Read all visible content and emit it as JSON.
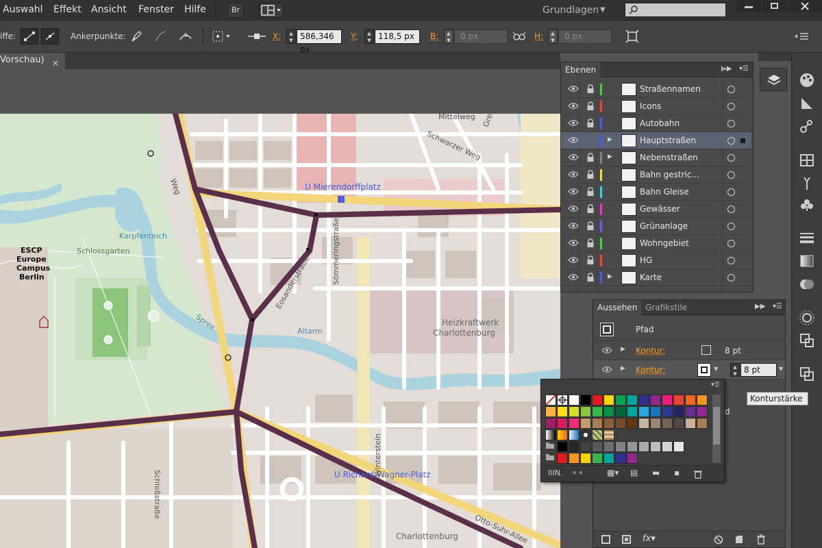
{
  "menubar": {
    "items": [
      "Auswahl",
      "Effekt",
      "Ansicht",
      "Fenster",
      "Hilfe"
    ],
    "bridge_label": "Br",
    "workspace": "Grundlagen",
    "search_placeholder": ""
  },
  "controlbar": {
    "left_label": "iffe:",
    "anchor_label": "Ankerpunkte:",
    "x_label": "X:",
    "x_value": "586,346 px",
    "y_label": "Y:",
    "y_value": "118,5 px",
    "b_label": "B:",
    "b_value": "0 px",
    "h_label": "H:",
    "h_value": "0 px"
  },
  "document": {
    "tab_title": "Vorschau)",
    "close_glyph": "×"
  },
  "map": {
    "labels": [
      "U Mierendorffplatz",
      "Karpfenteich",
      "Schlossgarten",
      "ESCP",
      "Europe",
      "Campus",
      "Berlin",
      "Spree",
      "Altarm",
      "Heizkraftwerk",
      "Charlottenburg",
      "Sömmeringstraße",
      "Mittelweg",
      "Schwarzer Weg",
      "U Richard-Wagner-Platz",
      "Otto-Suhr-Allee",
      "Schloßstraße",
      "Charlottenburg",
      "Gren",
      "Weg",
      "Eosanderstraße",
      "Winterstein"
    ]
  },
  "layers_panel": {
    "tab": "Ebenen",
    "layers": [
      {
        "name": "Straßennamen",
        "color": "#4ccc4c",
        "locked": true,
        "expandable": false,
        "selected": false
      },
      {
        "name": "Icons",
        "color": "#e04a3a",
        "locked": true,
        "expandable": false,
        "selected": false
      },
      {
        "name": "Autobahn",
        "color": "#4a5ee0",
        "locked": true,
        "expandable": false,
        "selected": false
      },
      {
        "name": "Hauptstraßen",
        "color": "#4a5ee0",
        "locked": false,
        "expandable": true,
        "selected": true
      },
      {
        "name": "Nebenstraßen",
        "color": "#808080",
        "locked": true,
        "expandable": true,
        "selected": false
      },
      {
        "name": "Bahn gestric...",
        "color": "#e6e04a",
        "locked": true,
        "expandable": false,
        "selected": false
      },
      {
        "name": "Bahn Gleise",
        "color": "#40d0e0",
        "locked": true,
        "expandable": false,
        "selected": false
      },
      {
        "name": "Gewässer",
        "color": "#e040c0",
        "locked": true,
        "expandable": false,
        "selected": false
      },
      {
        "name": "Grünanlage",
        "color": "#6a5ee0",
        "locked": true,
        "expandable": false,
        "selected": false
      },
      {
        "name": "Wohngebiet",
        "color": "#4ccc4c",
        "locked": true,
        "expandable": false,
        "selected": false
      },
      {
        "name": "HG",
        "color": "#e04a3a",
        "locked": true,
        "expandable": false,
        "selected": false
      },
      {
        "name": "Karte",
        "color": "#4a5ee0",
        "locked": true,
        "expandable": true,
        "selected": false
      }
    ]
  },
  "appearance_panel": {
    "tab_active": "Aussehen",
    "tab_other": "Grafikstile",
    "object": "Pfad",
    "rows": [
      {
        "label": "Kontur:",
        "value": "8 pt"
      },
      {
        "label": "Kontur:",
        "value": "8 pt"
      }
    ],
    "partial_text": "d"
  },
  "tooltip": {
    "text": "Konturstärke"
  },
  "colors": {
    "accent": "#f0a030",
    "selection": "#5b6271",
    "road": "#5a2f4a",
    "water": "#aad3df",
    "park": "#c8e6c0"
  }
}
